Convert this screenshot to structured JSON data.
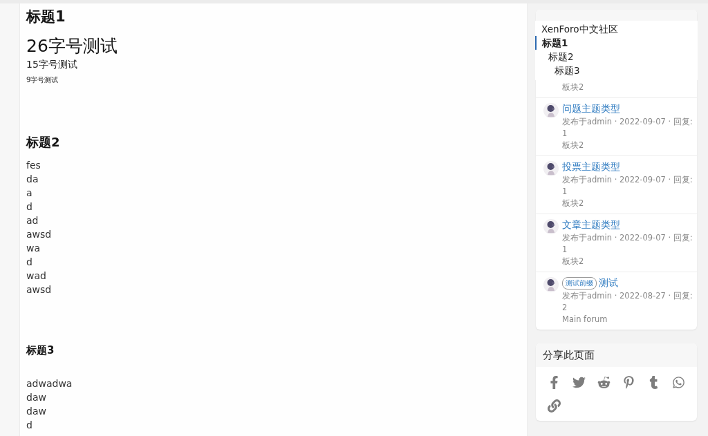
{
  "article": {
    "blocks": [
      {
        "kind": "heading1",
        "text": "标题1"
      },
      {
        "kind": "large",
        "text": "26字号测试"
      },
      {
        "kind": "medium",
        "text": "15字号测试"
      },
      {
        "kind": "small",
        "text": "9字号测试"
      },
      {
        "kind": "heading2",
        "text": "标题2"
      },
      {
        "kind": "line",
        "text": "fes"
      },
      {
        "kind": "line",
        "text": "da"
      },
      {
        "kind": "line",
        "text": "a"
      },
      {
        "kind": "line",
        "text": "d"
      },
      {
        "kind": "line",
        "text": "ad"
      },
      {
        "kind": "line",
        "text": "awsd"
      },
      {
        "kind": "line",
        "text": "wa"
      },
      {
        "kind": "line",
        "text": "d"
      },
      {
        "kind": "line",
        "text": "wad"
      },
      {
        "kind": "line",
        "text": "awsd"
      },
      {
        "kind": "heading3",
        "text": "标题3"
      },
      {
        "kind": "line",
        "text": "adwadwa"
      },
      {
        "kind": "line",
        "text": "daw"
      },
      {
        "kind": "line",
        "text": "daw"
      },
      {
        "kind": "line",
        "text": "d"
      }
    ]
  },
  "toc": {
    "title": "XenForo中文社区",
    "items": [
      {
        "label": "标题1",
        "selected": true,
        "children": [
          {
            "label": "标题2",
            "selected": false,
            "children": [
              {
                "label": "标题3",
                "selected": false
              }
            ]
          }
        ]
      }
    ]
  },
  "latest_threads": {
    "first_item_forum": "板块2",
    "items": [
      {
        "title": "问题主题类型",
        "meta": "发布于admin · 2022-09-07 · 回复:",
        "replies": "1",
        "forum": "板块2"
      },
      {
        "title": "投票主题类型",
        "meta": "发布于admin · 2022-09-07 · 回复:",
        "replies": "1",
        "forum": "板块2"
      },
      {
        "title": "文章主题类型",
        "meta": "发布于admin · 2022-09-07 · 回复:",
        "replies": "1",
        "forum": "板块2"
      },
      {
        "prefix": "测试前缀",
        "title": "测试",
        "meta": "发布于admin · 2022-08-27 · 回复:",
        "replies": "2",
        "forum": "Main forum"
      }
    ]
  },
  "share": {
    "title": "分享此页面"
  }
}
